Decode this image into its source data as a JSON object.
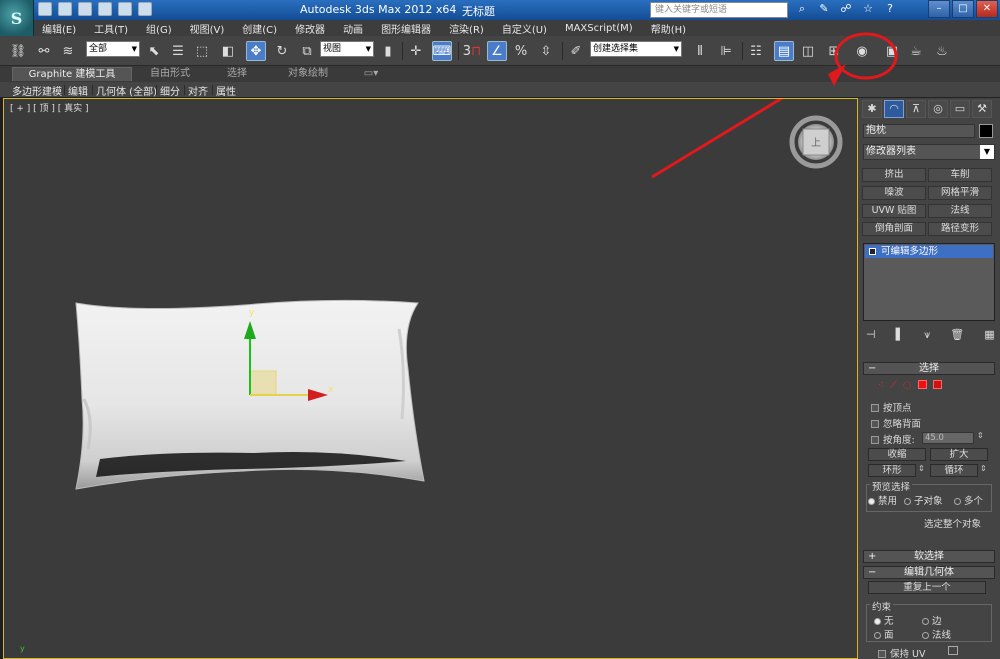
{
  "title_bar": {
    "app_title": "Autodesk 3ds Max  2012 x64",
    "doc_title": "无标题",
    "search_placeholder": "键入关键字或短语"
  },
  "menus": [
    "编辑(E)",
    "工具(T)",
    "组(G)",
    "视图(V)",
    "创建(C)",
    "修改器",
    "动画",
    "图形编辑器",
    "渲染(R)",
    "自定义(U)",
    "MAXScript(M)",
    "帮助(H)"
  ],
  "toolbar": {
    "selection_filter": "全部",
    "ref_coord": "视图",
    "named_selection": "创建选择集",
    "snap_count": "3"
  },
  "ribbon": {
    "tabs": [
      "Graphite 建模工具",
      "自由形式",
      "选择",
      "对象绘制"
    ],
    "sub_items": [
      "多边形建模",
      "编辑",
      "几何体 (全部)",
      "细分",
      "对齐",
      "属性"
    ]
  },
  "viewport": {
    "label": "[ + ] [ 顶 ] [ 真实 ]",
    "gizmo_axis_y": "y",
    "gizmo_axis_x": "x",
    "viewcube_label": "上",
    "world_axis_y": "y"
  },
  "command_panel": {
    "object_name": "抱枕",
    "modifier_list": "修改器列表",
    "modifier_buttons": [
      "挤出",
      "车削",
      "噪波",
      "网格平滑",
      "UVW 贴图",
      "法线",
      "倒角剖面",
      "路径变形"
    ],
    "stack_item": "可编辑多边形",
    "selection_rollout": {
      "title": "选择",
      "by_vertex": "按顶点",
      "ignore_backfacing": "忽略背面",
      "by_angle": "按角度:",
      "angle_value": "45.0",
      "shrink": "收缩",
      "grow": "扩大",
      "ring": "环形",
      "loop": "循环",
      "preview_group": "预览选择",
      "preview_options": [
        "禁用",
        "子对象",
        "多个"
      ],
      "select_whole": "选定整个对象"
    },
    "soft_selection": "软选择",
    "edit_geometry": "编辑几何体",
    "repeat_last": "重复上一个",
    "constraints_group": "约束",
    "constraints": [
      "无",
      "边",
      "面",
      "法线"
    ],
    "preserve_uv": "保持 UV"
  },
  "annotation": {
    "color": "#e0191c"
  }
}
